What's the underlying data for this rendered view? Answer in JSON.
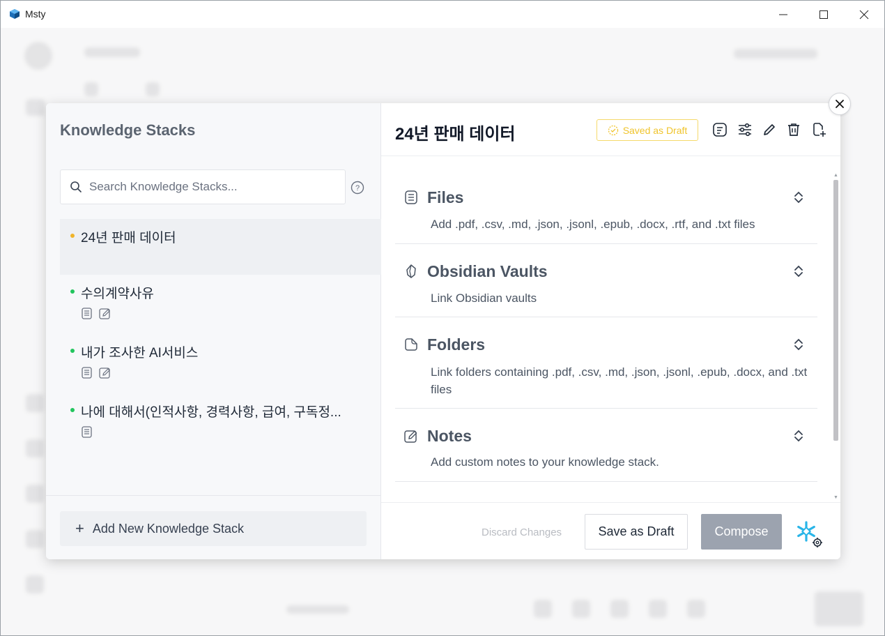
{
  "window": {
    "title": "Msty"
  },
  "modal": {
    "left": {
      "title": "Knowledge Stacks",
      "search_placeholder": "Search Knowledge Stacks...",
      "stacks": [
        {
          "name": "24년 판매 데이터",
          "status_color": "#f0b429",
          "active": true,
          "icons": []
        },
        {
          "name": "수의계약사유",
          "status_color": "#22c55e",
          "active": false,
          "icons": [
            "file-icon",
            "note-icon"
          ]
        },
        {
          "name": "내가 조사한 AI서비스",
          "status_color": "#22c55e",
          "active": false,
          "icons": [
            "file-icon",
            "note-icon"
          ]
        },
        {
          "name": "나에 대해서(인적사항, 경력사항, 급여, 구독정...",
          "status_color": "#22c55e",
          "active": false,
          "icons": [
            "file-icon"
          ]
        }
      ],
      "add_label": "Add New Knowledge Stack"
    },
    "right": {
      "title": "24년 판매 데이터",
      "draft_badge": "Saved as Draft",
      "sections": [
        {
          "title": "Files",
          "desc": "Add .pdf, .csv, .md, .json, .jsonl, .epub, .docx, .rtf, and .txt files"
        },
        {
          "title": "Obsidian Vaults",
          "desc": "Link Obsidian vaults"
        },
        {
          "title": "Folders",
          "desc": "Link folders containing .pdf, .csv, .md, .json, .jsonl, .epub, .docx, and .txt files"
        },
        {
          "title": "Notes",
          "desc": "Add custom notes to your knowledge stack."
        }
      ],
      "footer": {
        "discard": "Discard Changes",
        "save_draft": "Save as Draft",
        "compose": "Compose"
      }
    }
  },
  "colors": {
    "draft": "#f0c42c",
    "compose_bg": "#9ca3af",
    "snowflake": "#29b5e8"
  }
}
